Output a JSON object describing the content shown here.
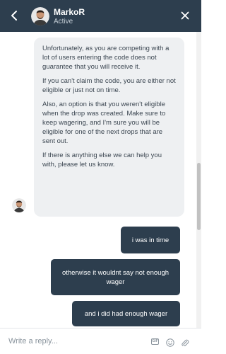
{
  "header": {
    "agent_name": "MarkoR",
    "status": "Active",
    "colors": {
      "background": "#2d3e4e",
      "text": "#ffffff"
    }
  },
  "messages": {
    "agent": {
      "paragraphs": [
        "Unfortunately, as you are competing with a lot of users entering the code does not guarantee that you will receive it.",
        "If you can't claim the code, you are either not eligible or just not on time.",
        "Also, an option is that you weren't eligible when the drop was created. Make sure to keep wagering, and I'm sure you will be eligible for one of the next drops that are sent out.",
        "If there is anything else we can help you with, please let us know."
      ]
    },
    "user": [
      "i was in time",
      "otherwise it wouldnt say not enough wager",
      "and i did had enough wager"
    ]
  },
  "composer": {
    "placeholder": "Write a reply...",
    "gif_label": "GIF",
    "icons": [
      "gif-icon",
      "emoji-icon",
      "paperclip-icon"
    ]
  },
  "icons": {
    "back": "chevron-left-icon",
    "close": "close-icon"
  },
  "colors": {
    "agent_bubble": "#eef0f2",
    "user_bubble": "#2d3e4e"
  }
}
